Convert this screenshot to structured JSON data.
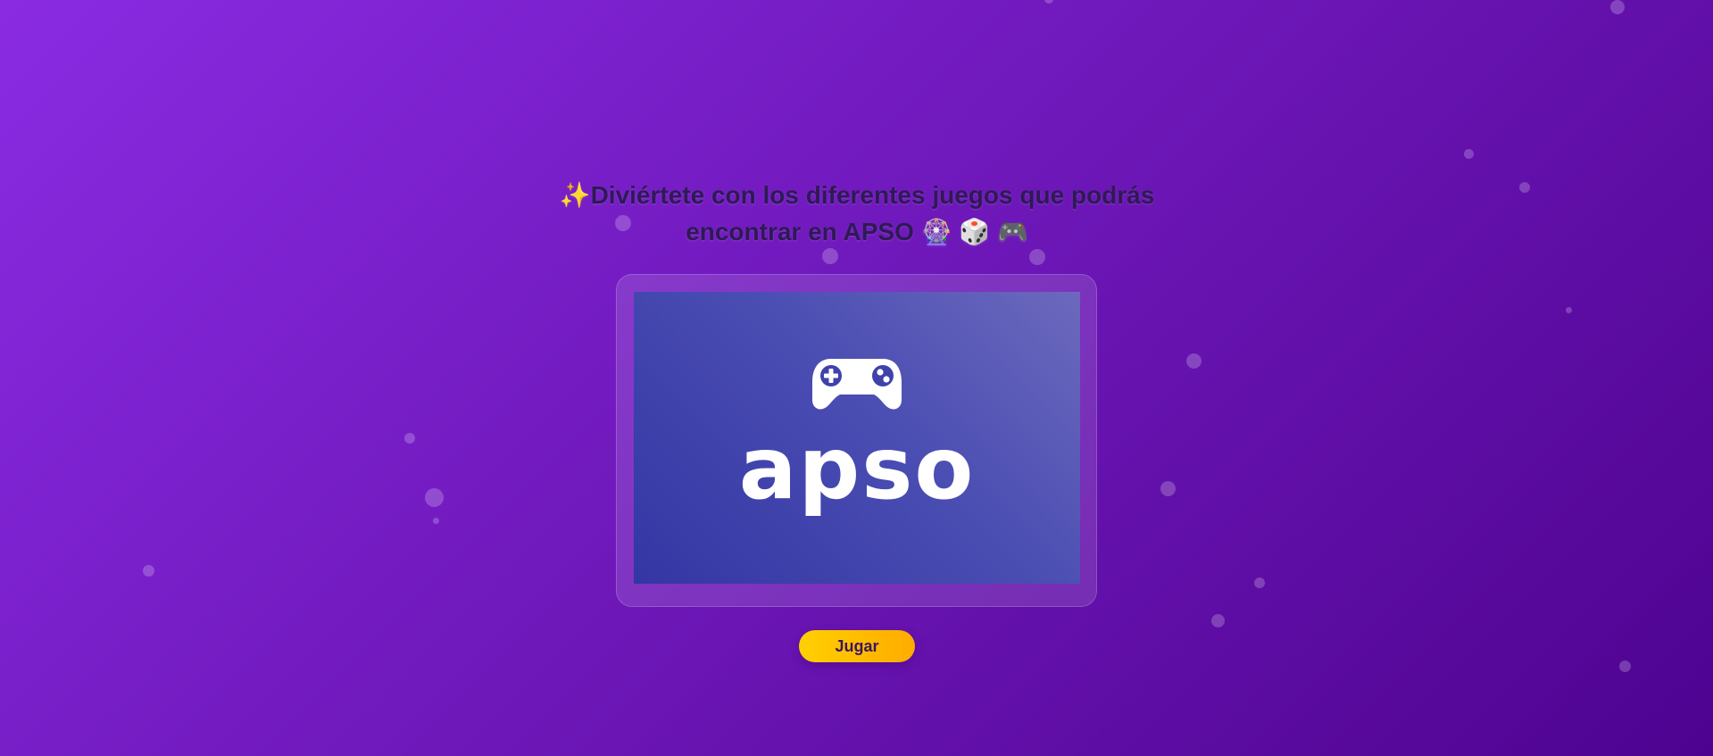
{
  "headline": {
    "text": "✨Diviértete con los diferentes juegos que podrás encontrar en APSO 🎡 🎲 🎮"
  },
  "card": {
    "logo_icon": "gamepad-icon",
    "logo_text": "apso"
  },
  "actions": {
    "play_label": "Jugar"
  },
  "colors": {
    "background_start": "#8a2be2",
    "background_end": "#4e0390",
    "button_start": "#ffd000",
    "button_end": "#ffab00"
  }
}
